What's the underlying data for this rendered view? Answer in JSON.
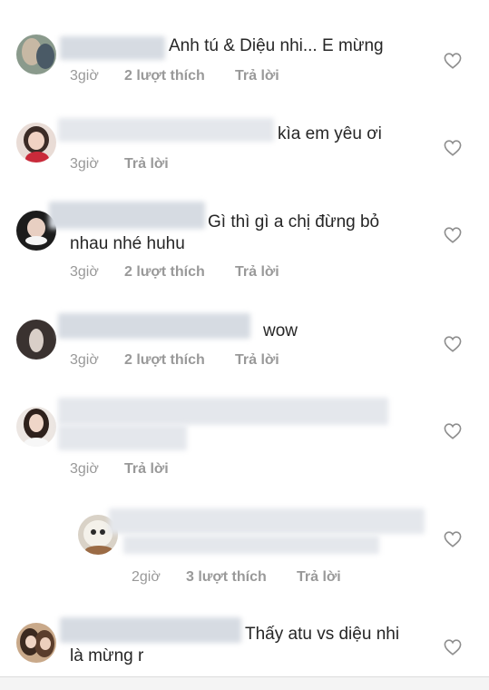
{
  "comments": [
    {
      "text_line1": "Anh tú & Diệu nhi... E mừng",
      "text_line2": "",
      "time": "3giờ",
      "likes": "2 lượt thích",
      "reply": "Trả lời"
    },
    {
      "text_line1": "kìa em yêu ơi",
      "text_line2": "",
      "time": "3giờ",
      "likes": "",
      "reply": "Trả lời"
    },
    {
      "text_line1": "Gì thì gì a chị đừng bỏ",
      "text_line2": "nhau nhé huhu",
      "time": "3giờ",
      "likes": "2 lượt thích",
      "reply": "Trả lời"
    },
    {
      "text_line1": "wow",
      "text_line2": "",
      "time": "3giờ",
      "likes": "2 lượt thích",
      "reply": "Trả lời"
    },
    {
      "text_line1": "",
      "text_line2": "",
      "time": "3giờ",
      "likes": "",
      "reply": "Trả lời"
    },
    {
      "text_line1": "",
      "text_line2": "",
      "time": "2giờ",
      "likes": "3 lượt thích",
      "reply": "Trả lời"
    },
    {
      "text_line1": "Thấy atu vs diệu nhi",
      "text_line2": "là mừng r",
      "time": "",
      "likes": "",
      "reply": ""
    }
  ],
  "icons": {
    "like": "heart-outline-icon"
  },
  "colors": {
    "text": "#262626",
    "meta": "#999999",
    "icon": "#8e8e8e",
    "background": "#ffffff"
  }
}
